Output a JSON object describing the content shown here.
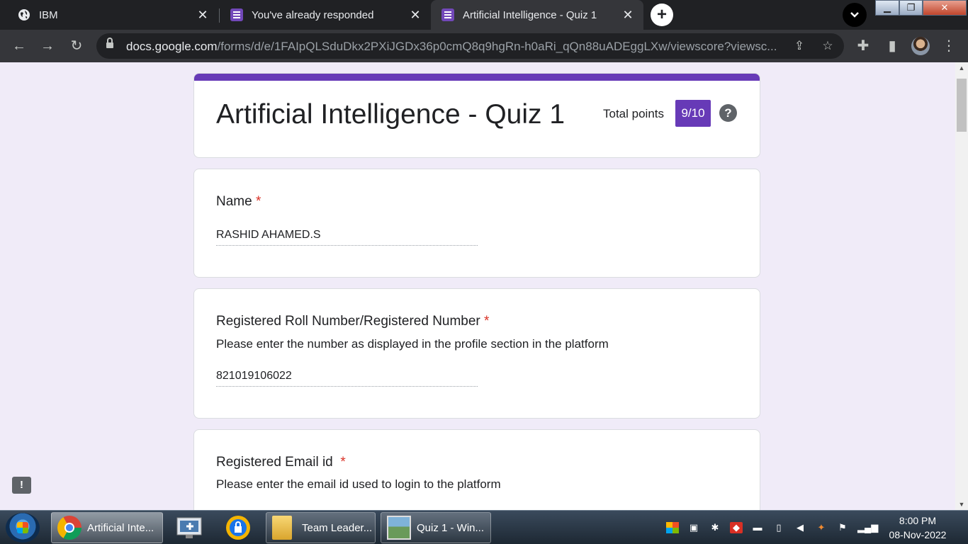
{
  "browser": {
    "tabs": [
      {
        "title": "IBM",
        "icon": "globe-icon",
        "active": false
      },
      {
        "title": "You've already responded",
        "icon": "forms-icon",
        "active": false
      },
      {
        "title": "Artificial Intelligence - Quiz 1",
        "icon": "forms-icon",
        "active": true
      }
    ],
    "url_host": "docs.google.com",
    "url_path": "/forms/d/e/1FAIpQLSduDkx2PXiJGDx36p0cmQ8q9hgRn-h0aRi_qQn88uADEggLXw/viewscore?viewsc..."
  },
  "form": {
    "title": "Artificial Intelligence - Quiz 1",
    "total_points_label": "Total points",
    "score": "9/10",
    "questions": [
      {
        "title": "Name",
        "required": "*",
        "description": "",
        "answer": "RASHID AHAMED.S"
      },
      {
        "title": "Registered Roll Number/Registered Number",
        "required": "*",
        "description": "Please enter the number as displayed in the profile section in the platform",
        "answer": "821019106022"
      },
      {
        "title": "Registered Email id",
        "required": "*",
        "description": "Please enter the email id used to login to the platform",
        "answer": ""
      }
    ]
  },
  "taskbar": {
    "tasks": [
      {
        "label": "Artificial Inte...",
        "icon": "chrome-icon",
        "active": true
      },
      {
        "label": "Team Leader...",
        "icon": "folder-icon",
        "active": false
      },
      {
        "label": "Quiz 1 - Win...",
        "icon": "image-viewer-icon",
        "active": false
      }
    ],
    "time": "8:00 PM",
    "date": "08-Nov-2022"
  },
  "colors": {
    "accent": "#673ab7",
    "background": "#f0ebf8",
    "required": "#d93025"
  }
}
